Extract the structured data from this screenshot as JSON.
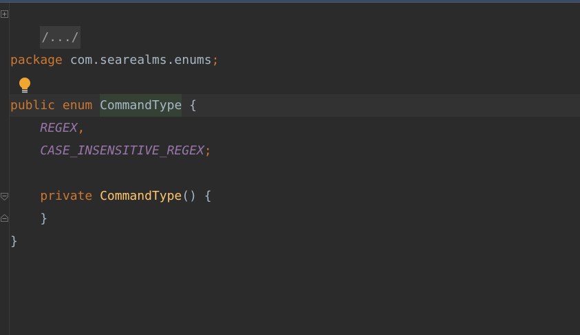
{
  "code": {
    "line1": {
      "folded": "/.../"
    },
    "line3": {
      "keyword": "package",
      "path": " com.searealms.enums",
      "semicolon": ";"
    },
    "line5": {
      "kw_public": "public",
      "kw_enum": "enum",
      "class_name": "CommandType",
      "brace": " {"
    },
    "line6": {
      "constant": "REGEX",
      "comma": ","
    },
    "line7": {
      "constant": "CASE_INSENSITIVE_REGEX",
      "semicolon": ";"
    },
    "line9": {
      "kw_private": "private",
      "method_name": "CommandType",
      "rest": "() {"
    },
    "line10": {
      "brace": "}"
    },
    "line11": {
      "brace": "}"
    }
  },
  "icons": {
    "fold_expand": "plus-square-icon",
    "fold_collapse": "minus-square-icon",
    "intention": "lightbulb-icon"
  },
  "colors": {
    "background": "#2b2b2b",
    "keyword": "#cc7832",
    "identifier": "#a9b7c6",
    "enum_constant": "#9876aa",
    "method": "#ffc66d",
    "bulb": "#f0a732"
  }
}
